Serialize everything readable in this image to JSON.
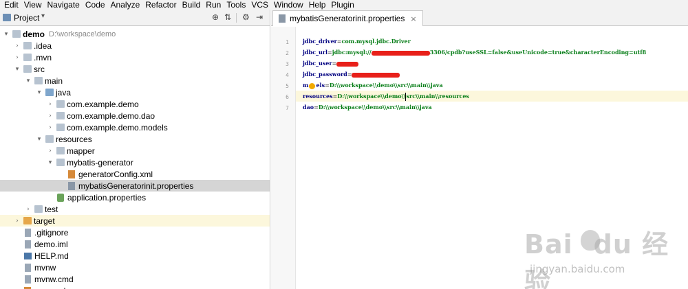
{
  "menu": [
    "Edit",
    "View",
    "Navigate",
    "Code",
    "Analyze",
    "Refactor",
    "Build",
    "Run",
    "Tools",
    "VCS",
    "Window",
    "Help",
    "Plugin"
  ],
  "project_panel": {
    "title": "Project",
    "dropdown_glyph": "▾",
    "toolbar_glyphs": [
      "⊕",
      "⇅",
      "⚙",
      "⇥"
    ]
  },
  "tree": [
    {
      "label": "demo",
      "path": "D:\\workspace\\demo",
      "depth": 0,
      "arrow": "▾",
      "icon": "folder-icon",
      "bold": true
    },
    {
      "label": ".idea",
      "depth": 1,
      "arrow": "›",
      "icon": "folder-icon"
    },
    {
      "label": ".mvn",
      "depth": 1,
      "arrow": "›",
      "icon": "folder-icon"
    },
    {
      "label": "src",
      "depth": 1,
      "arrow": "▾",
      "icon": "folder-icon"
    },
    {
      "label": "main",
      "depth": 2,
      "arrow": "▾",
      "icon": "folder-icon"
    },
    {
      "label": "java",
      "depth": 3,
      "arrow": "▾",
      "icon": "source-folder-icon"
    },
    {
      "label": "com.example.demo",
      "depth": 4,
      "arrow": "›",
      "icon": "package-icon"
    },
    {
      "label": "com.example.demo.dao",
      "depth": 4,
      "arrow": "›",
      "icon": "package-icon"
    },
    {
      "label": "com.example.demo.models",
      "depth": 4,
      "arrow": "›",
      "icon": "package-icon"
    },
    {
      "label": "resources",
      "depth": 3,
      "arrow": "▾",
      "icon": "resources-folder-icon"
    },
    {
      "label": "mapper",
      "depth": 4,
      "arrow": "›",
      "icon": "folder-icon"
    },
    {
      "label": "mybatis-generator",
      "depth": 4,
      "arrow": "▾",
      "icon": "folder-icon"
    },
    {
      "label": "generatorConfig.xml",
      "depth": 5,
      "arrow": "",
      "icon": "xml-file-icon"
    },
    {
      "label": "mybatisGeneratorinit.properties",
      "depth": 5,
      "arrow": "",
      "icon": "properties-file-icon",
      "selected": true
    },
    {
      "label": "application.properties",
      "depth": 4,
      "arrow": "",
      "icon": "spring-properties-icon"
    },
    {
      "label": "test",
      "depth": 2,
      "arrow": "›",
      "icon": "folder-icon"
    },
    {
      "label": "target",
      "depth": 1,
      "arrow": "›",
      "icon": "excluded-folder-icon",
      "highlighted": true
    },
    {
      "label": ".gitignore",
      "depth": 1,
      "arrow": "",
      "icon": "file-icon"
    },
    {
      "label": "demo.iml",
      "depth": 1,
      "arrow": "",
      "icon": "file-icon"
    },
    {
      "label": "HELP.md",
      "depth": 1,
      "arrow": "",
      "icon": "markdown-file-icon"
    },
    {
      "label": "mvnw",
      "depth": 1,
      "arrow": "",
      "icon": "file-icon"
    },
    {
      "label": "mvnw.cmd",
      "depth": 1,
      "arrow": "",
      "icon": "file-icon"
    },
    {
      "label": "pom.xml",
      "depth": 1,
      "arrow": "",
      "icon": "maven-file-icon"
    }
  ],
  "editor": {
    "tab_label": "mybatisGeneratorinit.properties",
    "tab_close": "×",
    "lines": [
      {
        "n": "1",
        "key": "jdbc_driver",
        "eq": "=",
        "pre": "com.mysql.jdbc.Driver",
        "redacted": false,
        "post": ""
      },
      {
        "n": "2",
        "key": "jdbc_url",
        "eq": "=",
        "pre": "jdbc:mysql://",
        "redacted": true,
        "post": "3306/cpdb?useSSL=false&useUnicode=true&characterEncoding=utf8"
      },
      {
        "n": "3",
        "key": "jdbc_user",
        "eq": "=",
        "pre": "",
        "redacted": true,
        "post": ""
      },
      {
        "n": "4",
        "key": "jdbc_password",
        "eq": "=",
        "pre": "",
        "redacted": true,
        "post": ""
      },
      {
        "n": "5",
        "key": "models",
        "key_a": "m",
        "key_b": "els",
        "eq": "=",
        "pre": "D:\\\\workspace\\\\demo\\\\src\\\\main\\\\java",
        "redacted": false,
        "post": "",
        "bulb": true
      },
      {
        "n": "6",
        "key": "resources",
        "eq": "=",
        "pre": "D:\\\\workspace\\\\demo\\\\",
        "caret": true,
        "post": "src\\\\main\\\\resources",
        "redacted": false,
        "current": true
      },
      {
        "n": "7",
        "key": "dao",
        "eq": "=",
        "pre": "D:\\\\workspace\\\\demo\\\\src\\\\main\\\\java",
        "redacted": false,
        "post": ""
      }
    ]
  },
  "watermark": {
    "logo_a": "Bai",
    "logo_b": "du",
    "logo_c": "经验",
    "url": "jingyan.baidu.com"
  },
  "colors": {
    "key": "#000080",
    "value": "#067d17",
    "redaction": "#e8201a",
    "selection": "#d5d5d5",
    "highlight": "#fcf7dc"
  }
}
